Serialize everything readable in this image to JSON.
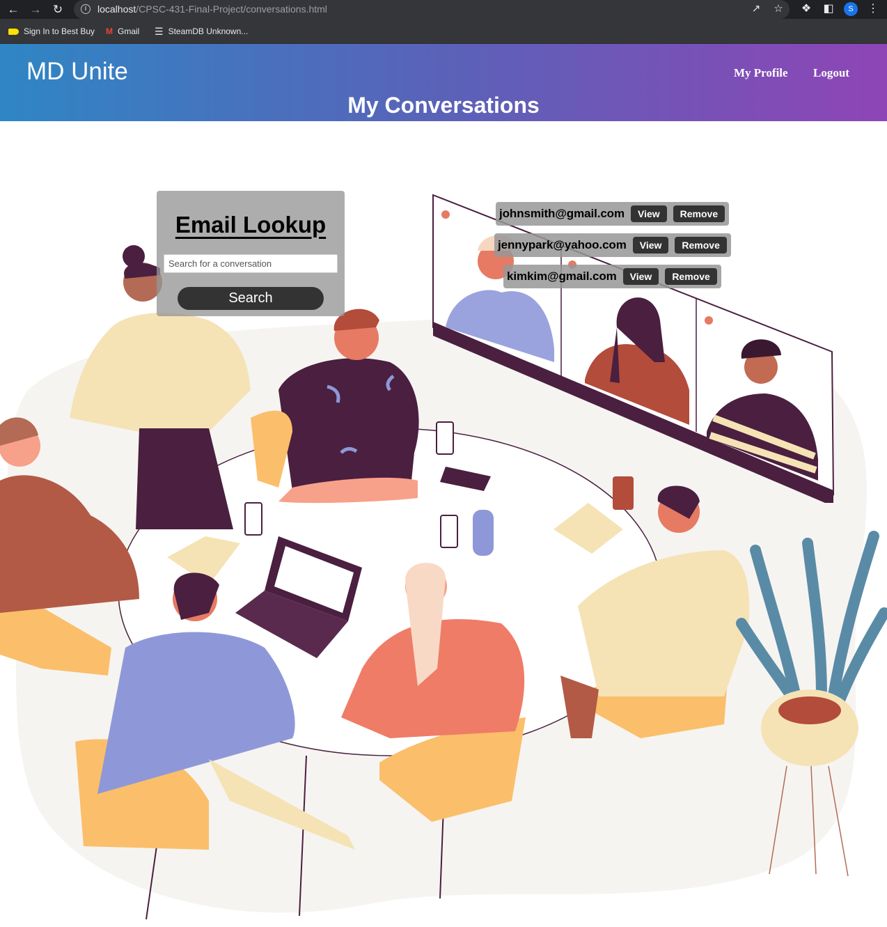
{
  "browser": {
    "url_host": "localhost",
    "url_path": "/CPSC-431-Final-Project/conversations.html",
    "profile_initial": "S",
    "bookmarks": [
      {
        "label": "Sign In to Best Buy",
        "icon": "bestbuy-tag-icon"
      },
      {
        "label": "Gmail",
        "icon": "gmail-icon"
      },
      {
        "label": "SteamDB Unknown...",
        "icon": "steamdb-icon"
      }
    ]
  },
  "header": {
    "brand": "MD Unite",
    "nav": [
      "My Profile",
      "Logout"
    ],
    "page_title": "My Conversations",
    "gradient": [
      "#2f86c4",
      "#5a62b8",
      "#8e45b5"
    ]
  },
  "lookup": {
    "title": "Email Lookup",
    "placeholder": "Search for a conversation",
    "button": "Search"
  },
  "conversations": [
    {
      "email": "johnsmith@gmail.com",
      "view": "View",
      "remove": "Remove"
    },
    {
      "email": "jennypark@yahoo.com",
      "view": "View",
      "remove": "Remove"
    },
    {
      "email": "kimkim@gmail.com",
      "view": "View",
      "remove": "Remove"
    }
  ],
  "illustration": {
    "subject": "team-meeting-with-video-call-illustration"
  }
}
